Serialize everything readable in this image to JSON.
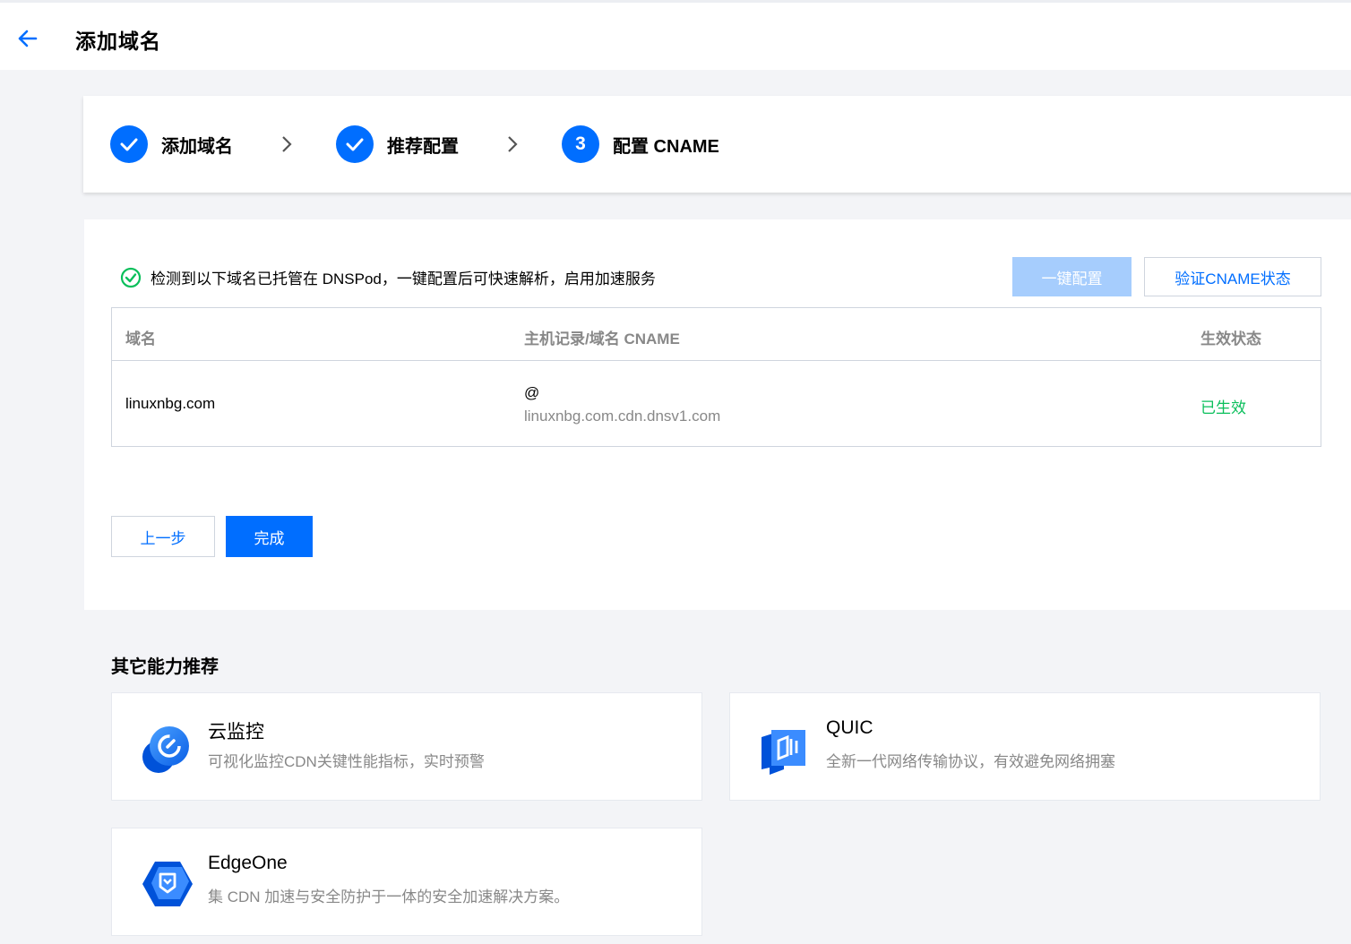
{
  "header": {
    "title": "添加域名"
  },
  "steps": [
    {
      "label": "添加域名",
      "status": "done"
    },
    {
      "label": "推荐配置",
      "status": "done"
    },
    {
      "number": "3",
      "label": "配置 CNAME",
      "status": "current"
    }
  ],
  "notice": {
    "text": "检测到以下域名已托管在 DNSPod，一键配置后可快速解析，启用加速服务"
  },
  "actions": {
    "one_click": "一键配置",
    "verify": "验证CNAME状态"
  },
  "table": {
    "columns": [
      "域名",
      "主机记录/域名 CNAME",
      "生效状态"
    ],
    "rows": [
      {
        "domain": "linuxnbg.com",
        "host": "@",
        "cname": "linuxnbg.com.cdn.dnsv1.com",
        "status": "已生效"
      }
    ]
  },
  "footer_buttons": {
    "prev": "上一步",
    "done": "完成"
  },
  "recommend": {
    "title": "其它能力推荐",
    "items": [
      {
        "name": "云监控",
        "desc": "可视化监控CDN关键性能指标，实时预警",
        "icon": "cloud-monitor-icon"
      },
      {
        "name": "QUIC",
        "desc": "全新一代网络传输协议，有效避免网络拥塞",
        "icon": "quic-icon"
      },
      {
        "name": "EdgeOne",
        "desc": "集 CDN 加速与安全防护于一体的安全加速解决方案。",
        "icon": "edgeone-icon"
      }
    ]
  },
  "colors": {
    "primary": "#006eff",
    "primary_disabled": "#a6cdfd",
    "success": "#0abf5b",
    "muted": "#888888"
  }
}
